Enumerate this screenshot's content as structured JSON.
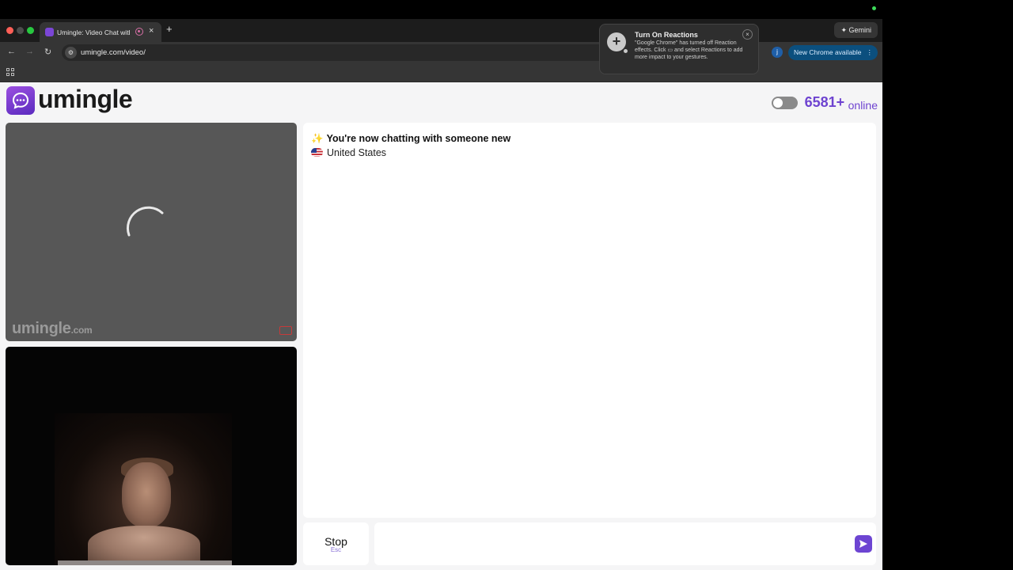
{
  "browser": {
    "tab_title": "Umingle: Video Chat with",
    "tab_close": "×",
    "new_tab": "+",
    "gemini_label": "✦ Gemini",
    "url": "umingle.com/video/",
    "profile_initial": "j",
    "update_button": "New Chrome available",
    "update_menu": "⋮",
    "nav_back": "←",
    "nav_forward": "→",
    "nav_reload": "↻"
  },
  "reactions_popup": {
    "title": "Turn On Reactions",
    "body": "\"Google Chrome\" has turned off Reaction effects. Click ▭ and select Reactions to add more impact to your gestures.",
    "close": "×",
    "icon": "+"
  },
  "header": {
    "logo_text": "umingle",
    "online_count": "6581+",
    "online_label": "online",
    "theme_toggle_on": false
  },
  "remote_video": {
    "watermark_brand": "umingle",
    "watermark_domain": ".com",
    "loading": true
  },
  "chat": {
    "status_icon": "✨",
    "status_message": "You're now chatting with someone new",
    "partner_country": "United States"
  },
  "controls": {
    "stop_label": "Stop",
    "stop_hint": "Esc",
    "message_placeholder": "",
    "accent_color": "#6e43d0"
  }
}
